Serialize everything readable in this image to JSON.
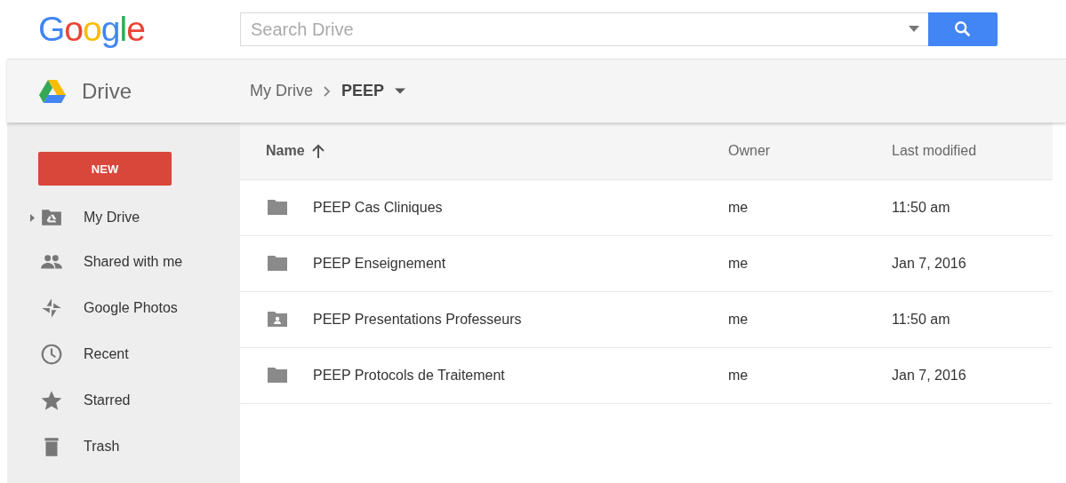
{
  "header": {
    "logo": "Google",
    "search": {
      "placeholder": "Search Drive"
    }
  },
  "appbar": {
    "title": "Drive",
    "breadcrumb": [
      "My Drive",
      "PEEP"
    ]
  },
  "sidebar": {
    "new_button": "NEW",
    "items": [
      {
        "label": "My Drive",
        "kind": "drive",
        "expandable": true
      },
      {
        "label": "Shared with me",
        "kind": "shared",
        "expandable": false
      },
      {
        "label": "Google Photos",
        "kind": "photos",
        "expandable": false
      },
      {
        "label": "Recent",
        "kind": "recent",
        "expandable": false
      },
      {
        "label": "Starred",
        "kind": "starred",
        "expandable": false
      },
      {
        "label": "Trash",
        "kind": "trash",
        "expandable": false
      }
    ]
  },
  "table": {
    "columns": [
      "Name",
      "Owner",
      "Last modified"
    ],
    "rows": [
      {
        "kind": "folder",
        "name": "PEEP Cas Cliniques",
        "owner": "me",
        "modified": "11:50 am"
      },
      {
        "kind": "folder",
        "name": "PEEP Enseignement",
        "owner": "me",
        "modified": "Jan 7, 2016"
      },
      {
        "kind": "shared-folder",
        "name": "PEEP Presentations Professeurs",
        "owner": "me",
        "modified": "11:50 am"
      },
      {
        "kind": "folder",
        "name": "PEEP Protocols de Traitement",
        "owner": "me",
        "modified": "Jan 7, 2016"
      }
    ]
  }
}
